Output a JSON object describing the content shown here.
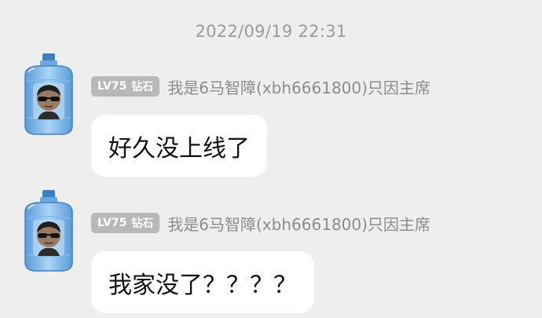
{
  "timestamp": "2022/09/19 22:31",
  "messages": [
    {
      "badge_level": "LV75",
      "badge_rank": "钻石",
      "username": "我是6马智障(xbh6661800)只因主席",
      "text": "好久没上线了",
      "avatar_icon": "water-jug-avatar-icon"
    },
    {
      "badge_level": "LV75",
      "badge_rank": "钻石",
      "username": "我是6马智障(xbh6661800)只因主席",
      "text": "我家没了？？？？",
      "avatar_icon": "water-jug-avatar-icon"
    }
  ],
  "colors": {
    "background": "#eeeeee",
    "bubble": "#ffffff",
    "badge": "#b8b8b8",
    "timestamp_text": "#9a9a9a",
    "username_text": "#8c8c8c",
    "message_text": "#111111"
  }
}
